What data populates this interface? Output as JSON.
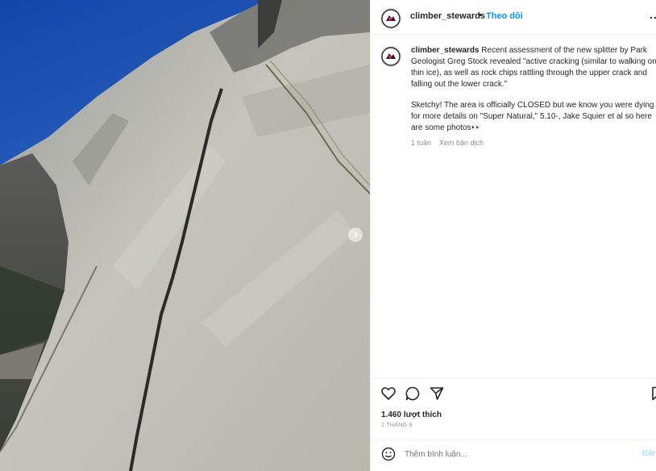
{
  "post": {
    "username": "climber_stewards",
    "dot": "•",
    "follow_label": "Theo dõi",
    "more_label": "...",
    "caption_user": "climber_stewards",
    "caption_p1": "Recent assessment of the new splitter by Park Geologist Greg Stock revealed \"active cracking (similar to walking on thin ice), as well as rock chips rattling through the upper crack and falling out the lower crack.\"",
    "caption_p2": "Sketchy! The area is officially CLOSED but we know you were dying for more details on \"Super Natural,\" 5.10-, Jake Squier et al so here are some photos👀",
    "time_ago": "1 tuần",
    "see_translation": "Xem bản dịch",
    "likes": "1.460 lượt thích",
    "date": "1 THÁNG 9",
    "comment_placeholder": "Thêm bình luận...",
    "post_button": "Đăng"
  },
  "icons": {
    "like": "heart-icon",
    "comment": "comment-icon",
    "share": "paper-plane-icon",
    "save": "bookmark-icon",
    "emoji": "smiley-icon",
    "next": "chevron-right-icon"
  },
  "colors": {
    "link": "#0095f6",
    "sky": "#1f56b0",
    "rock": "#b4b4ae"
  }
}
